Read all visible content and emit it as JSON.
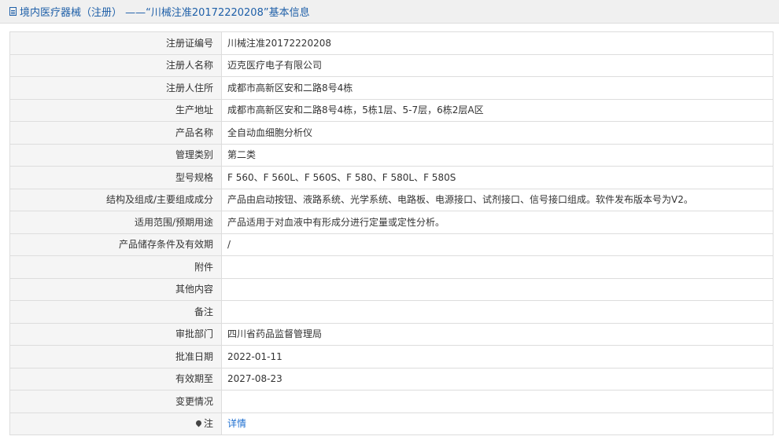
{
  "header": {
    "title": "境内医疗器械（注册） ——“川械注准20172220208”基本信息",
    "icon": "document-icon"
  },
  "rows": [
    {
      "label": "注册证编号",
      "value": "川械注准20172220208"
    },
    {
      "label": "注册人名称",
      "value": "迈克医疗电子有限公司"
    },
    {
      "label": "注册人住所",
      "value": "成都市高新区安和二路8号4栋"
    },
    {
      "label": "生产地址",
      "value": "成都市高新区安和二路8号4栋，5栋1层、5-7层，6栋2层A区"
    },
    {
      "label": "产品名称",
      "value": "全自动血细胞分析仪"
    },
    {
      "label": "管理类别",
      "value": "第二类"
    },
    {
      "label": "型号规格",
      "value": "F 560、F 560L、F 560S、F 580、F 580L、F 580S"
    },
    {
      "label": "结构及组成/主要组成成分",
      "value": "产品由启动按钮、液路系统、光学系统、电路板、电源接口、试剂接口、信号接口组成。软件发布版本号为V2。"
    },
    {
      "label": "适用范围/预期用途",
      "value": "产品适用于对血液中有形成分进行定量或定性分析。"
    },
    {
      "label": "产品储存条件及有效期",
      "value": "/"
    },
    {
      "label": "附件",
      "value": ""
    },
    {
      "label": "其他内容",
      "value": ""
    },
    {
      "label": "备注",
      "value": ""
    },
    {
      "label": "审批部门",
      "value": "四川省药品监督管理局"
    },
    {
      "label": "批准日期",
      "value": "2022-01-11"
    },
    {
      "label": "有效期至",
      "value": "2027-08-23"
    },
    {
      "label": "变更情况",
      "value": ""
    }
  ],
  "note_row": {
    "label": "注",
    "icon": "pin-icon",
    "link_text": "详情"
  },
  "colors": {
    "header_text": "#1e5fa8",
    "link": "#1e6fd0",
    "label_bg": "#f5f5f5",
    "border": "#dddddd"
  }
}
